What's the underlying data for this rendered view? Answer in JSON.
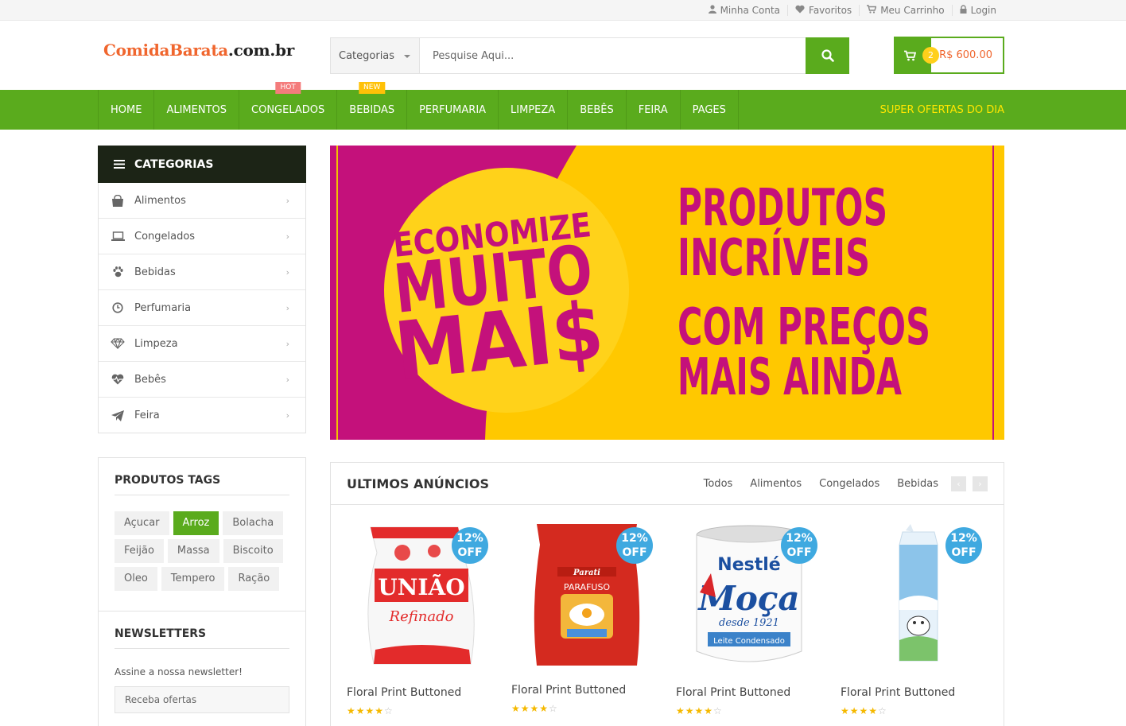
{
  "topbar": {
    "links": [
      {
        "label": "Minha Conta",
        "icon": "user-icon"
      },
      {
        "label": "Favoritos",
        "icon": "heart-icon"
      },
      {
        "label": "Meu Carrinho",
        "icon": "cart-icon"
      },
      {
        "label": "Login",
        "icon": "lock-icon"
      }
    ]
  },
  "header": {
    "logo_part1": "ComidaBarata",
    "logo_part2": ".com.br",
    "search_category": "Categorias",
    "search_placeholder": "Pesquise Aqui...",
    "cart_count": "2",
    "cart_total": "R$ 600.00"
  },
  "nav": {
    "items": [
      {
        "label": "HOME"
      },
      {
        "label": "ALIMENTOS"
      },
      {
        "label": "CONGELADOS",
        "tag": "HOT"
      },
      {
        "label": "BEBIDAS",
        "tag": "NEW"
      },
      {
        "label": "PERFUMARIA"
      },
      {
        "label": "LIMPEZA"
      },
      {
        "label": "BEBÊS"
      },
      {
        "label": "FEIRA"
      },
      {
        "label": "PAGES"
      }
    ],
    "super": "SUPER OFERTAS DO DIA"
  },
  "categories": {
    "title": "CATEGORIAS",
    "items": [
      {
        "label": "Alimentos",
        "icon": "shopping-bag-icon"
      },
      {
        "label": "Congelados",
        "icon": "laptop-icon"
      },
      {
        "label": "Bebidas",
        "icon": "paw-icon"
      },
      {
        "label": "Perfumaria",
        "icon": "clock-icon"
      },
      {
        "label": "Limpeza",
        "icon": "diamond-icon"
      },
      {
        "label": "Bebês",
        "icon": "heartbeat-icon"
      },
      {
        "label": "Feira",
        "icon": "paper-plane-icon"
      }
    ]
  },
  "tags": {
    "title": "PRODUTOS TAGS",
    "items": [
      "Açucar",
      "Arroz",
      "Bolacha",
      "Feijão",
      "Massa",
      "Biscoito",
      "Oleo",
      "Tempero",
      "Ração"
    ],
    "active": "Arroz"
  },
  "newsletter": {
    "title": "NEWSLETTERS",
    "text": "Assine a nossa newsletter!",
    "placeholder": "Receba ofertas"
  },
  "banner": {
    "line1": "ECONOMIZE",
    "line2": "MUITO",
    "line3": "MAI$",
    "right1": "PRODUTOS",
    "right2": "INCRÍVEIS",
    "right3": "COM PREÇOS",
    "right4": "MAIS AINDA",
    "colors": {
      "magenta": "#c4117b",
      "yellow": "#ffc800",
      "circle": "#ffd21a"
    }
  },
  "products": {
    "title": "ULTIMOS ANÚNCIOS",
    "tabs": [
      "Todos",
      "Alimentos",
      "Congelados",
      "Bebidas"
    ],
    "items": [
      {
        "name": "Floral Print Buttoned",
        "discount_pct": "12%",
        "discount_word": "OFF",
        "rating": 4,
        "image": "sugar-bag",
        "brand": "UNIÃO",
        "subtitle": "Refinado"
      },
      {
        "name": "Floral Print Buttoned",
        "discount_pct": "12%",
        "discount_word": "OFF",
        "rating": 4,
        "image": "pasta-bag",
        "brand": "Parati",
        "subtitle": "PARAFUSO"
      },
      {
        "name": "Floral Print Buttoned",
        "discount_pct": "12%",
        "discount_word": "OFF",
        "rating": 4,
        "image": "condensed-milk-can",
        "brand": "Nestlé",
        "subtitle": "Moça",
        "tagline": "desde 1921",
        "label": "Leite Condensado"
      },
      {
        "name": "Floral Print Buttoned",
        "discount_pct": "12%",
        "discount_word": "OFF",
        "rating": 4,
        "image": "milk-carton"
      }
    ]
  }
}
